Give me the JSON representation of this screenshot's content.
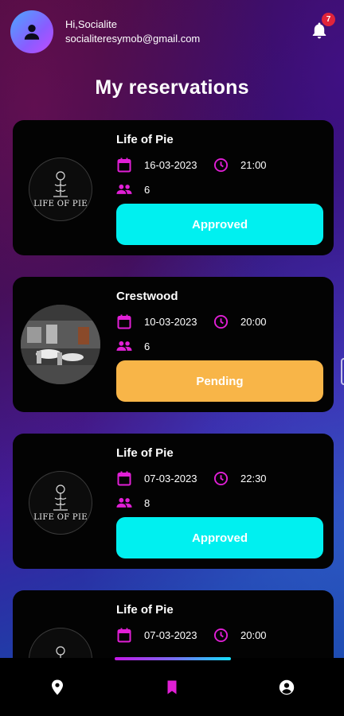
{
  "header": {
    "greeting": "Hi,Socialite",
    "email": "socialiteresymob@gmail.com",
    "notification_count": "7"
  },
  "page_title": "My reservations",
  "reservations": [
    {
      "restaurant": "Life of Pie",
      "date": "16-03-2023",
      "time": "21:00",
      "guests": "6",
      "status": "Approved",
      "logo_text": "LIFE OF PIE"
    },
    {
      "restaurant": "Crestwood",
      "date": "10-03-2023",
      "time": "20:00",
      "guests": "6",
      "status": "Pending"
    },
    {
      "restaurant": "Life of Pie",
      "date": "07-03-2023",
      "time": "22:30",
      "guests": "8",
      "status": "Approved",
      "logo_text": "LIFE OF PIE"
    },
    {
      "restaurant": "Life of Pie",
      "date": "07-03-2023",
      "time": "20:00",
      "guests": "",
      "status": "",
      "logo_text": ""
    }
  ],
  "nav": {
    "items": [
      "location-icon",
      "bookmark-icon",
      "account-icon"
    ],
    "active": "bookmark-icon"
  },
  "colors": {
    "accent": "#e11fd6",
    "approved": "#00f0f0",
    "pending": "#f8b548",
    "card": "#030303"
  }
}
